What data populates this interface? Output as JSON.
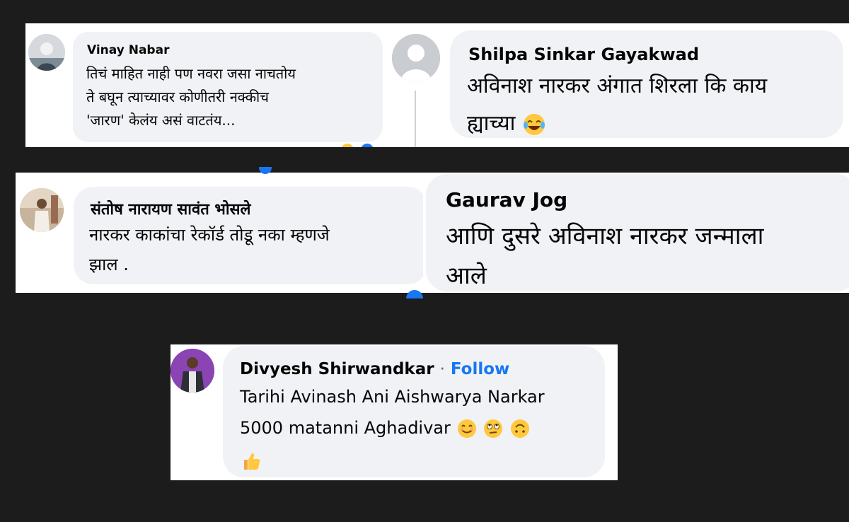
{
  "comments": [
    {
      "name": "Vinay Nabar",
      "lines": [
        "तिचं माहित नाही पण नवरा जसा नाचतोय",
        "ते बघून त्याच्यावर कोणीतरी नक्कीच",
        "'जारण' केलंय असं वाटतंय..."
      ]
    },
    {
      "name": "Shilpa Sinkar Gayakwad",
      "lines": [
        "अविनाश नारकर अंगात शिरला कि काय",
        "ह्याच्या"
      ]
    },
    {
      "name": "संतोष नारायण सावंत भोसले",
      "lines": [
        "नारकर काकांचा रेकॉर्ड तोडू नका म्हणजे",
        "झाल ."
      ]
    },
    {
      "name": "Gaurav Jog",
      "lines": [
        "आणि दुसरे अविनाश नारकर जन्माला",
        "आले"
      ]
    },
    {
      "name": "Divyesh Shirwandkar",
      "separator": "·",
      "follow": "Follow",
      "lines": [
        "Tarihi Avinash Ani Aishwarya Narkar",
        "5000 matanni Aghadivar"
      ]
    }
  ],
  "icons": {
    "laugh_tears": "laughing-with-tears-emoji",
    "smile": "smiling-emoji",
    "eyeroll": "eye-roll-emoji",
    "upside_down": "upside-down-face-emoji",
    "thumbs_up": "thumbs-up-emoji"
  },
  "colors": {
    "background": "#1c1c1c",
    "panel": "#ffffff",
    "bubble": "#f0f2f5",
    "text": "#050505",
    "link": "#1877f2",
    "emoji": "#ffc83d"
  }
}
